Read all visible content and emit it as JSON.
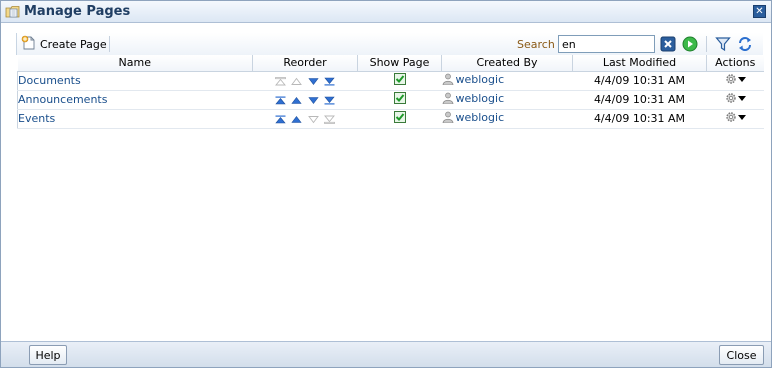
{
  "dialog": {
    "title": "Manage Pages",
    "title_icon": "folder-page-icon"
  },
  "toolbar": {
    "create_label": "Create Page",
    "search_label": "Search",
    "search_value": "en",
    "icons": [
      "clear-search-icon",
      "go-icon",
      "filter-icon",
      "refresh-icon"
    ]
  },
  "table": {
    "headers": [
      "Name",
      "Reorder",
      "Show Page",
      "Created By",
      "Last Modified",
      "Actions"
    ],
    "rows": [
      {
        "name": "Documents",
        "show": true,
        "created_by": "weblogic",
        "modified": "4/4/09 10:31 AM"
      },
      {
        "name": "Announcements",
        "show": true,
        "created_by": "weblogic",
        "modified": "4/4/09 10:31 AM"
      },
      {
        "name": "Events",
        "show": true,
        "created_by": "weblogic",
        "modified": "4/4/09 10:31 AM"
      }
    ]
  },
  "footer": {
    "help_label": "Help",
    "close_label": "Close"
  },
  "colors": {
    "link": "#1a4f8c",
    "search_label": "#8a5a16",
    "reorder_active": "#2f6fd1",
    "reorder_disabled": "#b8b8b8",
    "check": "#2aa12a"
  }
}
